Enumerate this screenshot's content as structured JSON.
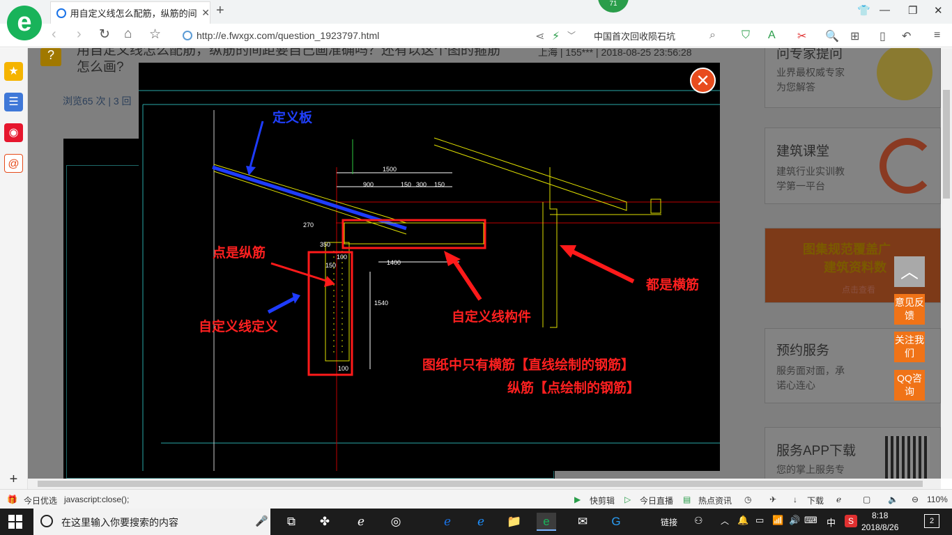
{
  "browser": {
    "tab_title": "用自定义线怎么配筋，纵筋的间距",
    "badge": "71",
    "url": "http://e.fwxgx.com/question_1923797.html",
    "news_text": "中国首次回收陨石坑",
    "zoom": "110%"
  },
  "question": {
    "title": "用自定义线怎么配筋，纵筋的间距要自己画准确吗？还有以这个图的箍筋怎么画?",
    "meta": "上海 | 155*** | 2018-08-25 23:56:28",
    "views": "浏览65 次 | 3 回"
  },
  "sidebar_cards": [
    {
      "title": "问专家提问",
      "sub1": "业界最权威专家",
      "sub2": "为您解答"
    },
    {
      "title": "建筑课堂",
      "sub1": "建筑行业实训教",
      "sub2": "学第一平台"
    },
    {
      "title": "图集规范覆盖广",
      "sub1": "建筑资料数",
      "sub2": "点击查看"
    },
    {
      "title": "预约服务",
      "sub1": "服务面对面，承",
      "sub2": "诺心连心"
    },
    {
      "title": "服务APP下载",
      "sub1": "您的掌上服务专",
      "sub2": ""
    }
  ],
  "float_buttons": {
    "feedback": "意见反馈",
    "follow": "关注我们",
    "qq": "QQ咨询"
  },
  "drawing": {
    "labels": {
      "def_board": "定义板",
      "dots_long": "点是纵筋",
      "custom_def": "自定义线定义",
      "custom_comp": "自定义线构件",
      "all_trans": "都是横筋",
      "note1": "图纸中只有横筋【直线绘制的钢筋】",
      "note2": "纵筋【点绘制的钢筋】"
    },
    "dims": {
      "d1500": "1500",
      "d900": "900",
      "d150a": "150",
      "d300": "300",
      "d150b": "150",
      "d1400": "1400",
      "d1540": "1540",
      "d150c": "150",
      "d100": "100",
      "d270": "270",
      "d350": "350",
      "d100b": "100"
    }
  },
  "statusbar": {
    "today": "今日优选",
    "js": "javascript:close();",
    "kuaijian": "快剪辑",
    "live": "今日直播",
    "hot": "热点资讯",
    "download": "下载",
    "zoom": "110%"
  },
  "taskbar": {
    "search_placeholder": "在这里输入你要搜索的内容",
    "link": "链接",
    "ime": "中",
    "time": "8:18",
    "date": "2018/8/26",
    "notif": "2"
  }
}
